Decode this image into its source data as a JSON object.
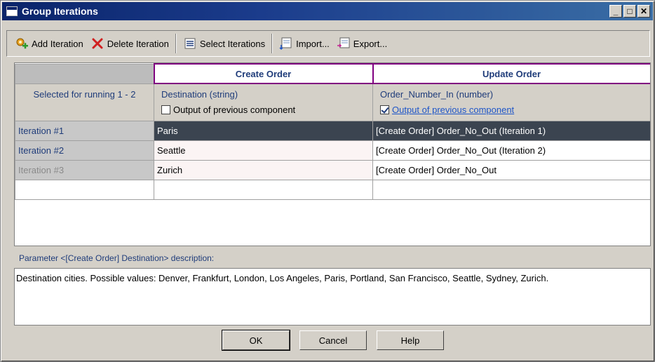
{
  "window": {
    "title": "Group Iterations"
  },
  "title_buttons": {
    "minimize": "_",
    "maximize": "□",
    "close": "✕"
  },
  "toolbar": {
    "add_label": "Add Iteration",
    "delete_label": "Delete Iteration",
    "select_label": "Select Iterations",
    "import_label": "Import...",
    "export_label": "Export..."
  },
  "grid": {
    "groups": [
      "Create Order",
      "Update Order"
    ],
    "selected_label": "Selected for running 1 - 2",
    "params": [
      {
        "name": "Destination (string)",
        "checkbox_label": "Output of previous component",
        "checked": false
      },
      {
        "name": "Order_Number_In (number)",
        "checkbox_label": "Output of previous component",
        "checked": true
      }
    ],
    "rows": [
      {
        "label": "Iteration #1",
        "c1": "Paris",
        "c2": "[Create Order] Order_No_Out (Iteration 1)"
      },
      {
        "label": "Iteration #2",
        "c1": "Seattle",
        "c2": "[Create Order] Order_No_Out (Iteration 2)"
      },
      {
        "label": "Iteration #3",
        "c1": "Zurich",
        "c2": "[Create Order] Order_No_Out"
      }
    ]
  },
  "description": {
    "label": "Parameter <[Create Order] Destination> description:",
    "text": "Destination cities. Possible values: Denver, Frankfurt, London, Los Angeles, Paris, Portland, San Francisco, Seattle, Sydney, Zurich."
  },
  "buttons": {
    "ok": "OK",
    "cancel": "Cancel",
    "help": "Help"
  }
}
